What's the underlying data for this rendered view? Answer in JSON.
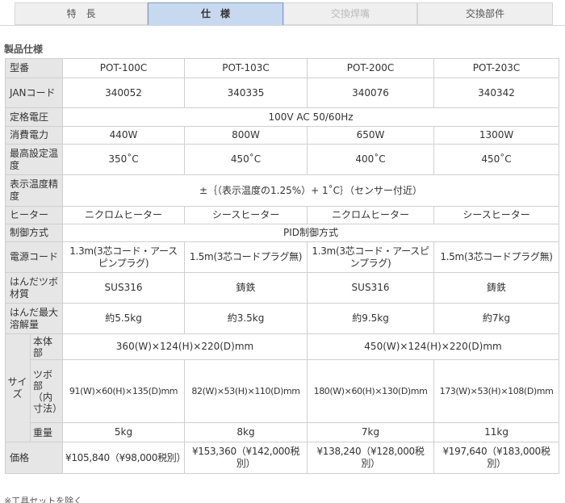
{
  "tabs": [
    {
      "label": "特　長"
    },
    {
      "label": "仕　様"
    },
    {
      "label": "交換焊嘴"
    },
    {
      "label": "交換部件"
    }
  ],
  "section_title": "製品仕様",
  "table": {
    "header": {
      "label": "型番",
      "models": [
        "POT-100C",
        "POT-103C",
        "POT-200C",
        "POT-203C"
      ]
    },
    "jan": {
      "label": "JANコード",
      "values": [
        "340052",
        "340335",
        "340076",
        "340342"
      ]
    },
    "voltage": {
      "label": "定格電圧",
      "value": "100V AC 50/60Hz"
    },
    "power": {
      "label": "消費電力",
      "values": [
        "440W",
        "800W",
        "650W",
        "1300W"
      ]
    },
    "max_temp": {
      "label": "最高設定温度",
      "values": [
        "350˚C",
        "450˚C",
        "400˚C",
        "450˚C"
      ]
    },
    "accuracy": {
      "label": "表示温度精度",
      "value": "±｛（表示温度の1.25%）+ 1˚C｝（センサー付近）"
    },
    "heater": {
      "label": "ヒーター",
      "values": [
        "ニクロムヒーター",
        "シースヒーター",
        "ニクロムヒーター",
        "シースヒーター"
      ]
    },
    "control": {
      "label": "制御方式",
      "value": "PID制御方式"
    },
    "cord": {
      "label": "電源コード",
      "values": [
        "1.3m(3芯コード・アースピンプラグ)",
        "1.5m(3芯コードプラグ無)",
        "1.3m(3芯コード・アースピンプラグ)",
        "1.5m(3芯コードプラグ無)"
      ]
    },
    "pot_material": {
      "label": "はんだツボ材質",
      "values": [
        "SUS316",
        "鋳鉄",
        "SUS316",
        "鋳鉄"
      ]
    },
    "capacity": {
      "label": "はんだ最大溶解量",
      "values": [
        "約5.5kg",
        "約3.5kg",
        "約9.5kg",
        "約7kg"
      ]
    },
    "size": {
      "label": "サイズ",
      "body": {
        "label": "本体部",
        "values": [
          "360(W)×124(H)×220(D)mm",
          "450(W)×124(H)×220(D)mm"
        ]
      },
      "pot": {
        "label": "ツボ部（内寸法）",
        "values": [
          "91(W)×60(H)×135(D)mm",
          "82(W)×53(H)×110(D)mm",
          "180(W)×60(H)×130(D)mm",
          "173(W)×53(H)×108(D)mm"
        ]
      },
      "weight": {
        "label": "重量",
        "values": [
          "5kg",
          "8kg",
          "7kg",
          "11kg"
        ]
      }
    },
    "price": {
      "label": "価格",
      "values": [
        "¥105,840（¥98,000税別）",
        "¥153,360（¥142,000税別）",
        "¥138,240（¥128,000税別）",
        "¥197,640（¥183,000税別）"
      ]
    }
  },
  "footnote": "※工具セットを除く"
}
